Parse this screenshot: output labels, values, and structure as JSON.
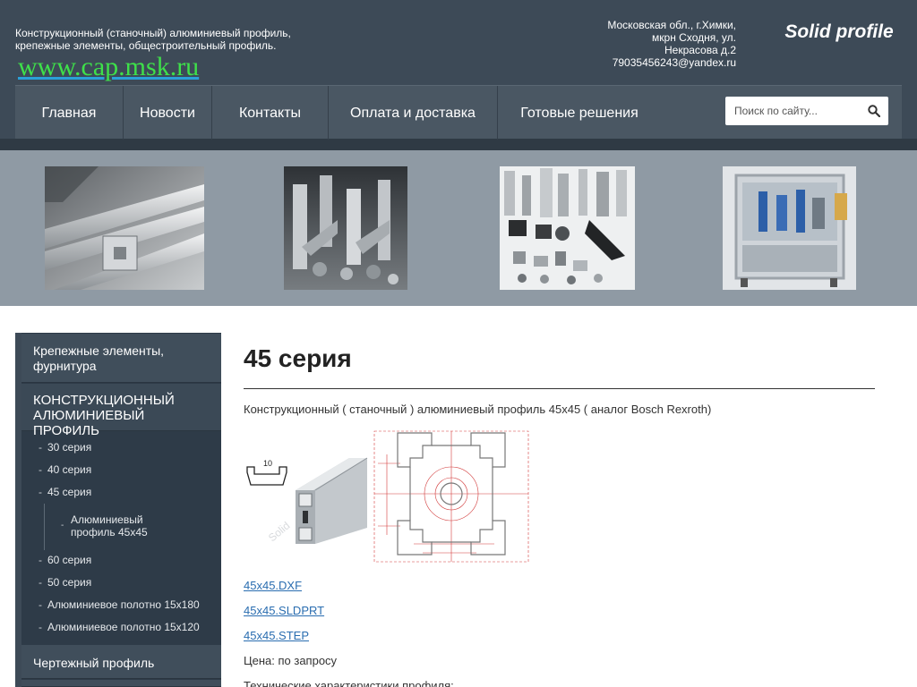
{
  "header": {
    "tagline": "Конструкционный (станочный) алюминиевый профиль, крепежные элементы, общестроительный профиль.",
    "site_url": "www.cap.msk.ru",
    "address_lines": [
      "Московская обл., г.Химки,",
      "мкрн Сходня, ул.",
      "Некрасова д.2",
      "79035456243@yandex.ru"
    ],
    "brand": "Solid profile"
  },
  "nav": {
    "items": [
      "Главная",
      "Новости",
      "Контакты",
      "Оплата и доставка",
      "Готовые решения"
    ]
  },
  "search": {
    "placeholder": "Поиск по сайту...",
    "icon": "search-icon"
  },
  "banner": {
    "images": [
      "profiles-photo",
      "connectors-photo",
      "fasteners-photo",
      "machine-photo"
    ]
  },
  "sidebar": {
    "sections": [
      {
        "label": "Крепежные элементы, фурнитура"
      },
      {
        "label": "КОНСТРУКЦИОННЫЙ АЛЮМИНИЕВЫЙ ПРОФИЛЬ",
        "active": true
      },
      {
        "label": "Чертежный профиль"
      }
    ],
    "subitems": [
      "30 серия",
      "40 серия",
      "45 серия",
      "60 серия",
      "50 серия",
      "Алюминиевое полотно 15x180",
      "Алюминиевое полотно 15x120"
    ],
    "subsubitem": "Алюминиевый профиль 45х45"
  },
  "main": {
    "title": "45 серия",
    "intro": "Конструкционный ( станочный ) алюминиевый профиль 45х45 ( аналог Bosch Rexroth)",
    "figure_label": "10",
    "figure_watermark": "Solid",
    "links": [
      "45x45.DXF",
      "45x45.SLDPRT",
      "45x45.STEP"
    ],
    "price": "Цена: по запросу",
    "tech": "Технические характеристики профиля:"
  },
  "colors": {
    "header_bg": "#3d4a57",
    "nav_bg": "#4a5763",
    "banner_bg": "#8f9aa4",
    "sidebar_bg": "#2e3b48",
    "url_green": "#3ee04a",
    "link_blue": "#2a6db0"
  }
}
